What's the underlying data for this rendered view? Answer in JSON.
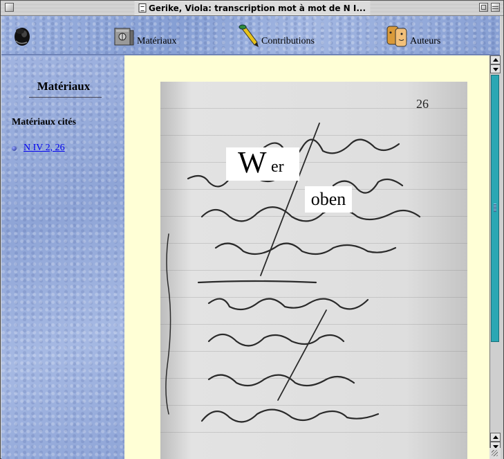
{
  "window": {
    "title": "Gerike, Viola: transcription mot à mot de N I..."
  },
  "nav": {
    "items": [
      {
        "label": "Matériaux",
        "icon": "safe-icon"
      },
      {
        "label": "Contributions",
        "icon": "pen-icon"
      },
      {
        "label": "Auteurs",
        "icon": "faces-icon"
      }
    ]
  },
  "sidebar": {
    "title": "Matériaux",
    "subtitle": "Matériaux cités",
    "links": [
      "N IV 2, 26"
    ]
  },
  "content": {
    "overlay_word1_big": "W",
    "overlay_word1_small": "er",
    "overlay_word2": "oben",
    "page_number": "26"
  }
}
